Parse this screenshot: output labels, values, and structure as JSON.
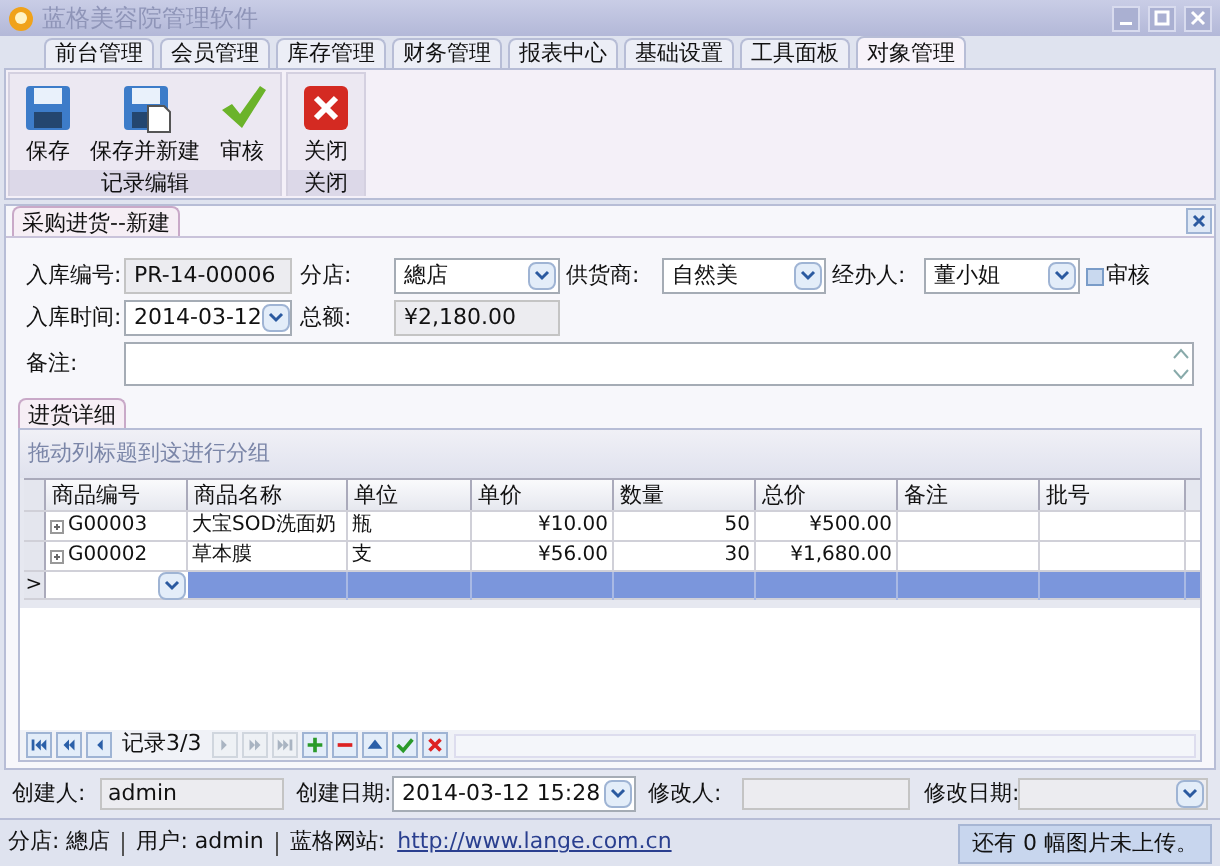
{
  "window": {
    "title": "蓝格美容院管理软件"
  },
  "menu_tabs": [
    {
      "label": "前台管理",
      "selected": false
    },
    {
      "label": "会员管理",
      "selected": false
    },
    {
      "label": "库存管理",
      "selected": false
    },
    {
      "label": "财务管理",
      "selected": false
    },
    {
      "label": "报表中心",
      "selected": false
    },
    {
      "label": "基础设置",
      "selected": false
    },
    {
      "label": "工具面板",
      "selected": false
    },
    {
      "label": "对象管理",
      "selected": true
    }
  ],
  "ribbon_groups": [
    {
      "label": "记录编辑",
      "buttons": [
        {
          "kind": "save",
          "label": "保存"
        },
        {
          "kind": "save_new",
          "label": "保存并新建"
        },
        {
          "kind": "approve",
          "label": "审核"
        }
      ]
    },
    {
      "label": "关闭",
      "buttons": [
        {
          "kind": "close",
          "label": "关闭"
        }
      ]
    }
  ],
  "document_tab": {
    "label": "采购进货--新建"
  },
  "form": {
    "receipt_no": {
      "label": "入库编号:",
      "value": "PR-14-00006"
    },
    "branch": {
      "label": "分店:",
      "value": "總店"
    },
    "supplier": {
      "label": "供货商:",
      "value": "自然美"
    },
    "handler": {
      "label": "经办人:",
      "value": "董小姐"
    },
    "approved": {
      "label": "审核",
      "checked": false
    },
    "receipt_time": {
      "label": "入库时间:",
      "value": "2014-03-12"
    },
    "total": {
      "label": "总额:",
      "value": "¥2,180.00"
    },
    "note": {
      "label": "备注:"
    }
  },
  "detail_tab": {
    "label": "进货详细"
  },
  "grid": {
    "group_hint": "拖动列标题到这进行分组",
    "columns": [
      "商品编号",
      "商品名称",
      "单位",
      "单价",
      "数量",
      "总价",
      "备注",
      "批号"
    ],
    "rows": [
      {
        "cells": [
          "G00003",
          "大宝SOD洗面奶",
          "瓶",
          "¥10.00",
          "50",
          "¥500.00",
          "",
          ""
        ],
        "selected": false
      },
      {
        "cells": [
          "G00002",
          "草本膜",
          "支",
          "¥56.00",
          "30",
          "¥1,680.00",
          "",
          ""
        ],
        "selected": false
      }
    ],
    "new_row": {
      "indicator": ">",
      "selected": true
    }
  },
  "navigator": {
    "record_text": "记录3/3",
    "buttons": [
      {
        "kind": "first",
        "disabled": false
      },
      {
        "kind": "prev_page",
        "disabled": false
      },
      {
        "kind": "prev",
        "disabled": false
      },
      {
        "kind": "next",
        "disabled": true
      },
      {
        "kind": "next_page",
        "disabled": true
      },
      {
        "kind": "last",
        "disabled": true
      },
      {
        "kind": "add",
        "disabled": false
      },
      {
        "kind": "remove",
        "disabled": false
      },
      {
        "kind": "edit",
        "disabled": false
      },
      {
        "kind": "post",
        "disabled": false
      },
      {
        "kind": "cancel",
        "disabled": false
      }
    ]
  },
  "audit": {
    "creator": {
      "label": "创建人:",
      "value": "admin"
    },
    "created": {
      "label": "创建日期:",
      "value": "2014-03-12 15:28"
    },
    "modifier": {
      "label": "修改人:"
    },
    "modified": {
      "label": "修改日期:"
    }
  },
  "status_bar": {
    "branch": "分店: 總店",
    "user": "用户: admin",
    "site_label": "蓝格网站:",
    "site_link": "http://www.lange.com.cn",
    "upload": "还有 0 幅图片未上传。"
  }
}
